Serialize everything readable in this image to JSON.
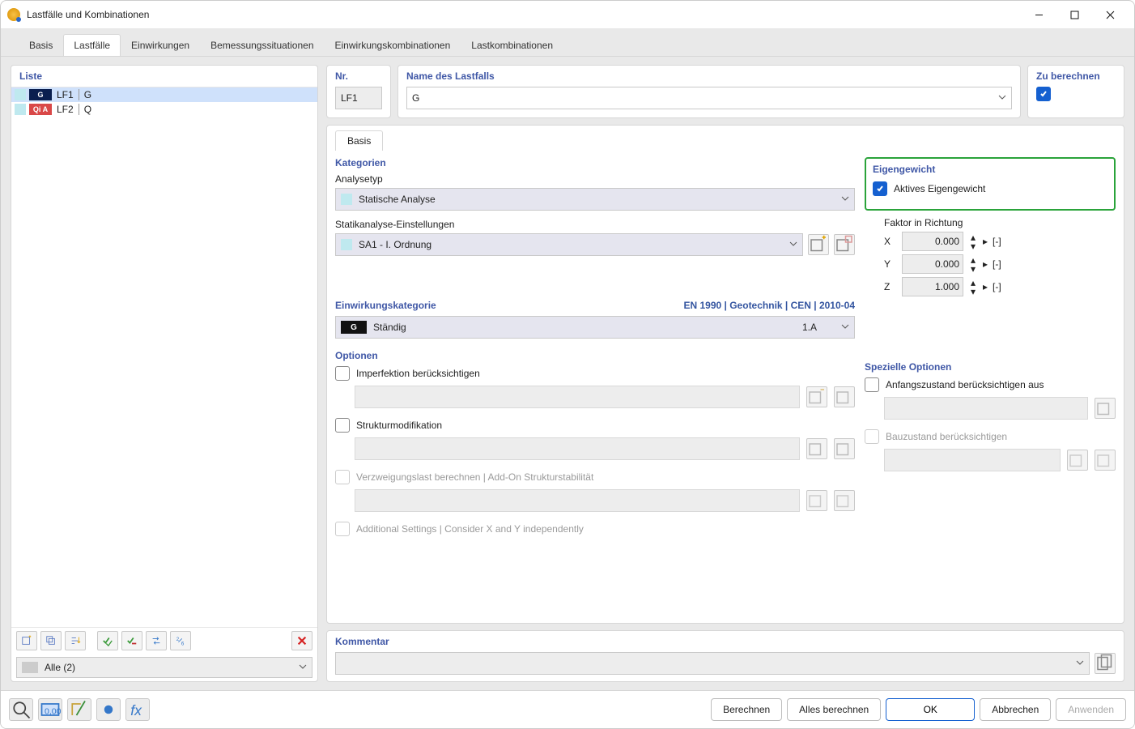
{
  "window": {
    "title": "Lastfälle und Kombinationen"
  },
  "tabs": [
    "Basis",
    "Lastfälle",
    "Einwirkungen",
    "Bemessungssituationen",
    "Einwirkungskombinationen",
    "Lastkombinationen"
  ],
  "active_tab": 1,
  "list": {
    "title": "Liste",
    "items": [
      {
        "badge": "G",
        "badge_class": "g",
        "id": "LF1",
        "name": "G",
        "selected": true
      },
      {
        "badge": "Qi A",
        "badge_class": "q",
        "id": "LF2",
        "name": "Q",
        "selected": false
      }
    ],
    "filter": "Alle (2)"
  },
  "header": {
    "nr_label": "Nr.",
    "nr_value": "LF1",
    "name_label": "Name des Lastfalls",
    "name_value": "G",
    "calc_label": "Zu berechnen",
    "calc_checked": true
  },
  "subtab": "Basis",
  "categories": {
    "title": "Kategorien",
    "analysis_label": "Analysetyp",
    "analysis_value": "Statische Analyse",
    "settings_label": "Statikanalyse-Einstellungen",
    "settings_value": "SA1 - I. Ordnung"
  },
  "selfweight": {
    "title": "Eigengewicht",
    "active_label": "Aktives Eigengewicht",
    "active_checked": true,
    "factor_label": "Faktor in Richtung",
    "rows": [
      {
        "axis": "X",
        "value": "0.000",
        "unit": "[-]"
      },
      {
        "axis": "Y",
        "value": "0.000",
        "unit": "[-]"
      },
      {
        "axis": "Z",
        "value": "1.000",
        "unit": "[-]"
      }
    ]
  },
  "action_category": {
    "title": "Einwirkungskategorie",
    "standard": "EN 1990 | Geotechnik | CEN | 2010-04",
    "badge": "G",
    "value": "Ständig",
    "code": "1.A"
  },
  "options": {
    "title": "Optionen",
    "imperfection": "Imperfektion berücksichtigen",
    "struct_mod": "Strukturmodifikation",
    "branching": "Verzweigungslast berechnen | Add-On Strukturstabilität",
    "additional": "Additional Settings | Consider X and Y independently"
  },
  "special_options": {
    "title": "Spezielle Optionen",
    "initial": "Anfangszustand berücksichtigen aus",
    "construction": "Bauzustand berücksichtigen"
  },
  "comment": {
    "title": "Kommentar"
  },
  "footer": {
    "calc": "Berechnen",
    "calc_all": "Alles berechnen",
    "ok": "OK",
    "cancel": "Abbrechen",
    "apply": "Anwenden"
  }
}
